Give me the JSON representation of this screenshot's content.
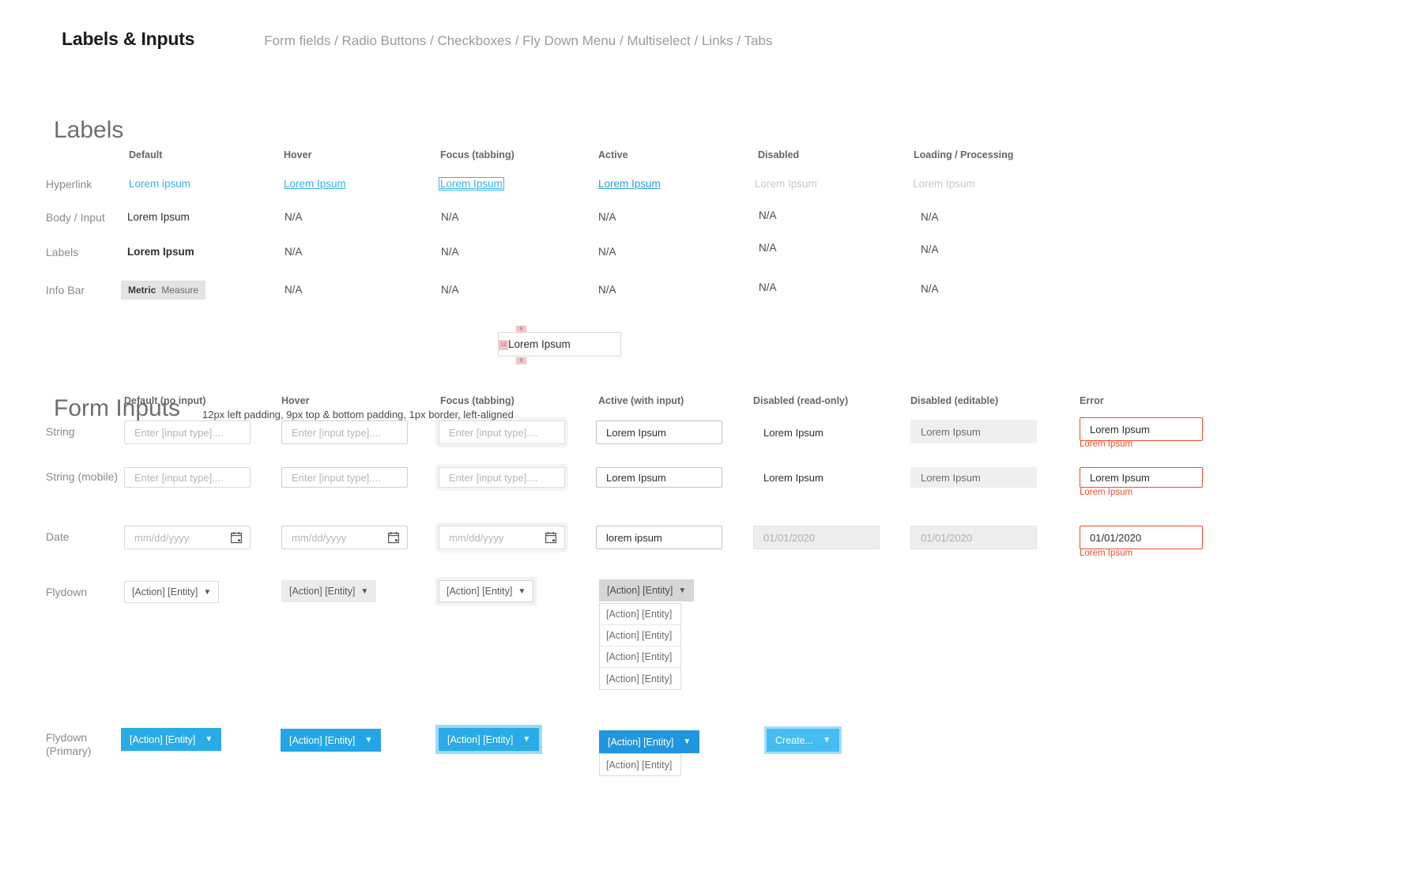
{
  "header": {
    "title": "Labels & Inputs",
    "breadcrumb": "Form fields / Radio Buttons / Checkboxes / Fly Down Menu / Multiselect / Links / Tabs"
  },
  "labels_section": {
    "title": "Labels",
    "columns": [
      "Default",
      "Hover",
      "Focus (tabbing)",
      "Active",
      "Disabled",
      "Loading / Processing"
    ],
    "rows": [
      {
        "label": "Hyperlink",
        "cells": [
          "Lorem ipsum",
          "Lorem Ipsum",
          "Lorem Ipsum",
          "Lorem Ipsum",
          "Lorem Ipsum",
          "Lorem Ipsum"
        ]
      },
      {
        "label": "Body / Input",
        "cells": [
          "Lorem Ipsum",
          "N/A",
          "N/A",
          "N/A",
          "N/A",
          "N/A"
        ]
      },
      {
        "label": "Labels",
        "cells": [
          "Lorem Ipsum",
          "N/A",
          "N/A",
          "N/A",
          "N/A",
          "N/A"
        ]
      },
      {
        "label": "Info Bar",
        "cells": [
          "",
          "N/A",
          "N/A",
          "N/A",
          "N/A",
          "N/A"
        ],
        "badge": {
          "metric": "Metric",
          "measure": "Measure"
        }
      }
    ]
  },
  "forms_section": {
    "title": "Form Inputs",
    "note": "12px left padding, 9px top & bottom padding,  1px border, left-aligned",
    "padding_demo": {
      "value": "Lorem Ipsum",
      "left": "12",
      "top": "9",
      "bottom": "9"
    },
    "columns": [
      "Default (no input)",
      "Hover",
      "Focus (tabbing)",
      "Active (with input)",
      "Disabled (read-only)",
      "Disabled (editable)",
      "Error"
    ],
    "rows": {
      "string": {
        "label": "String",
        "placeholder": "Enter [input type]....",
        "active_value": "Lorem Ipsum",
        "readonly_value": "Lorem Ipsum",
        "disabled_value": "Lorem Ipsum",
        "error_value": "Lorem Ipsum",
        "error_message": "Lorem Ipsum"
      },
      "string_mobile": {
        "label": "String (mobile)",
        "placeholder": "Enter [input type]....",
        "active_value": "Lorem Ipsum",
        "readonly_value": "Lorem Ipsum",
        "disabled_value": "Lorem Ipsum",
        "error_value": "Lorem Ipsum",
        "error_message": "Lorem Ipsum"
      },
      "date": {
        "label": "Date",
        "placeholder": "mm/dd/yyyy",
        "active_value": "lorem ipsum",
        "readonly_value": "01/01/2020",
        "disabled_value": "01/01/2020",
        "error_value": "01/01/2020",
        "error_message": "Lorem Ipsum"
      },
      "flydown": {
        "label": "Flydown",
        "button_label": "[Action] [Entity]",
        "caret": "▼",
        "menu_items": [
          "[Action] [Entity]",
          "[Action] [Entity]",
          "[Action] [Entity]",
          "[Action] [Entity]"
        ]
      },
      "flydown_primary": {
        "label_line1": "Flydown",
        "label_line2": "(Primary)",
        "button_label": "[Action] [Entity]",
        "caret": "▼",
        "menu_items": [
          "[Action] [Entity]"
        ],
        "create_label": "Create..."
      }
    }
  },
  "colors": {
    "link": "#35b3ea",
    "primary": "#29abe8",
    "primary_light": "#45bdf3",
    "error": "#ee4d2b",
    "badge_bg": "#e3e3e3",
    "annotation": "#f6c2cb"
  }
}
